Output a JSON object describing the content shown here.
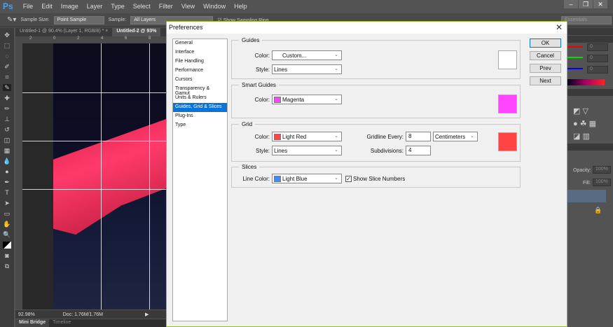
{
  "app": {
    "logo": "Ps",
    "menu": [
      "File",
      "Edit",
      "Image",
      "Layer",
      "Type",
      "Select",
      "Filter",
      "View",
      "Window",
      "Help"
    ],
    "window_buttons": [
      "minimize",
      "restore",
      "close"
    ]
  },
  "options": {
    "sample_size_label": "Sample Size:",
    "sample_size": "Point Sample",
    "sample_label": "Sample:",
    "sample": "All Layers",
    "show_ring": "Show Sampling Ring",
    "workspace": "Essentials"
  },
  "tabs": [
    {
      "label": "Untitled-1 @ 90.4% (Layer 1, RGB/8) *",
      "close": "×"
    },
    {
      "label": "Untitled-2 @ 93%"
    }
  ],
  "ruler_ticks": [
    "2",
    "0",
    "2",
    "4",
    "6",
    "8"
  ],
  "status": {
    "zoom": "92.98%",
    "doc": "Doc: 1.76M/1.76M"
  },
  "bottom_tabs": [
    "Mini Bridge",
    "Timeline"
  ],
  "right_panel": {
    "rgb": [
      "0",
      "0",
      "0"
    ],
    "opacity_label": "Opacity:",
    "opacity": "100%",
    "fill_label": "Fill:",
    "fill": "100%"
  },
  "dialog": {
    "title": "Preferences",
    "close": "✕",
    "categories": [
      "General",
      "Interface",
      "File Handling",
      "Performance",
      "Cursors",
      "Transparency & Gamut",
      "Units & Rulers",
      "Guides, Grid & Slices",
      "Plug-Ins",
      "Type"
    ],
    "selected": "Guides, Grid & Slices",
    "buttons": [
      "OK",
      "Cancel",
      "Prev",
      "Next"
    ],
    "guides": {
      "legend": "Guides",
      "color_label": "Color:",
      "color": "Custom...",
      "style_label": "Style:",
      "style": "Lines",
      "swatch": "#ffffff"
    },
    "smart_guides": {
      "legend": "Smart Guides",
      "color_label": "Color:",
      "color": "Magenta",
      "swatch": "#ff44ff"
    },
    "grid": {
      "legend": "Grid",
      "color_label": "Color:",
      "color": "Light Red",
      "color_swatch": "#ff4444",
      "style_label": "Style:",
      "style": "Lines",
      "gridline_label": "Gridline Every:",
      "gridline": "8",
      "unit": "Centimeters",
      "subdiv_label": "Subdivisions:",
      "subdiv": "4"
    },
    "slices": {
      "legend": "Slices",
      "line_color_label": "Line Color:",
      "line_color": "Light Blue",
      "swatch": "#4a86f0",
      "show_numbers": "Show Slice Numbers",
      "show_numbers_checked": true
    }
  }
}
